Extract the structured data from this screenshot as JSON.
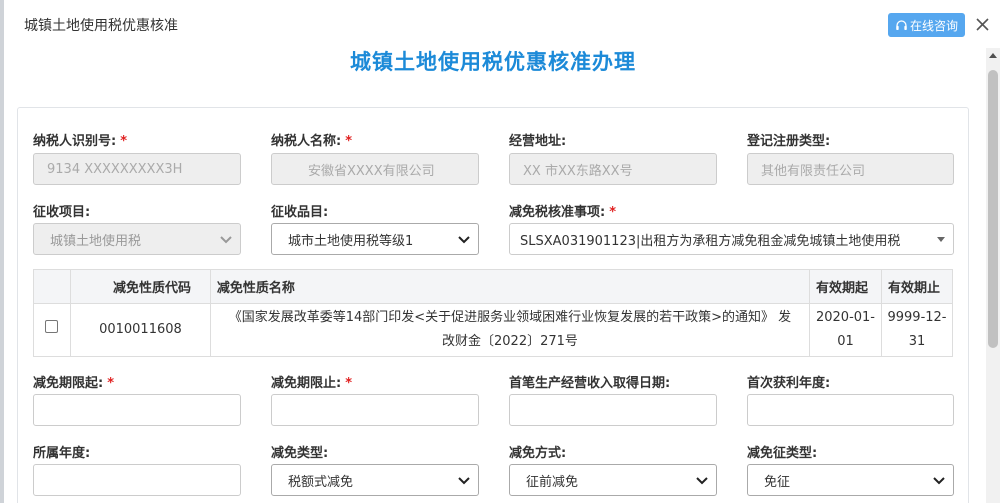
{
  "window": {
    "title": "城镇土地使用税优惠核准",
    "consult_label": "在线咨询"
  },
  "page_title": "城镇土地使用税优惠核准办理",
  "fields": {
    "taxpayer_id": {
      "label": "纳税人识别号:",
      "value": "9134 XXXXXXXXX3H",
      "required": "*"
    },
    "taxpayer_name": {
      "label": "纳税人名称:",
      "value": "安徽省XXXX有限公司",
      "required": "*"
    },
    "address": {
      "label": "经营地址:",
      "value": "XX 市XX东路XX号"
    },
    "reg_type": {
      "label": "登记注册类型:",
      "value": "其他有限责任公司"
    },
    "levy_item": {
      "label": "征收项目:",
      "value": "城镇土地使用税"
    },
    "levy_product": {
      "label": "征收品目:",
      "value": "城市土地使用税等级1"
    },
    "exemption_matter": {
      "label": "减免税核准事项:",
      "value": "SLSXA031901123|出租方为承租方减免租金减免城镇土地使用税",
      "required": "*"
    },
    "start_date": {
      "label": "减免期限起:",
      "value": "",
      "required": "*"
    },
    "end_date": {
      "label": "减免期限止:",
      "value": "",
      "required": "*"
    },
    "first_income_date": {
      "label": "首笔生产经营收入取得日期:",
      "value": ""
    },
    "first_profit_year": {
      "label": "首次获利年度:",
      "value": ""
    },
    "year": {
      "label": "所属年度:",
      "value": ""
    },
    "exemption_type": {
      "label": "减免类型:",
      "value": "税额式减免"
    },
    "exemption_method": {
      "label": "减免方式:",
      "value": "征前减免"
    },
    "exemption_levy_type": {
      "label": "减免征类型:",
      "value": "免征"
    }
  },
  "table": {
    "headers": {
      "code": "减免性质代码",
      "name": "减免性质名称",
      "valid_from": "有效期起",
      "valid_to": "有效期止"
    },
    "rows": [
      {
        "code": "0010011608",
        "name_line1": "《国家发展改革委等14部门印发<关于促进服务业领域困难行业恢复发展的若干政策>的通知》 发",
        "name_line2": "改财金〔2022〕271号",
        "valid_from_line1": "2020-01-",
        "valid_from_line2": "01",
        "valid_to_line1": "9999-12-",
        "valid_to_line2": "31"
      }
    ]
  },
  "colors": {
    "accent": "#1c8ad8",
    "consult_button": "#56a7ef",
    "required": "#e02020"
  },
  "icons": {
    "consult": "headset-icon",
    "close": "close-icon"
  }
}
